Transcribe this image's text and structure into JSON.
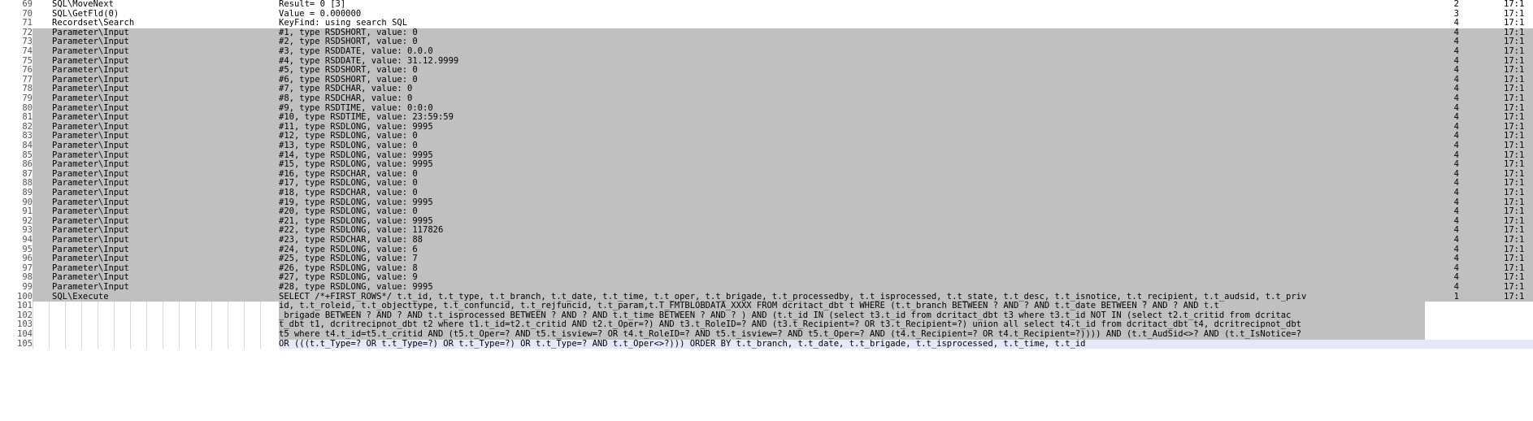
{
  "rows": [
    {
      "n": "69",
      "name": "SQL\\MoveNext",
      "msg": "Result= 0 [3]",
      "lvl": "2",
      "time": "17:1"
    },
    {
      "n": "70",
      "name": "SQL\\GetFld(0)",
      "msg": "Value = 0.000000",
      "lvl": "3",
      "time": "17:1"
    },
    {
      "n": "71",
      "name": "Recordset\\Search",
      "msg": "KeyFind: using search SQL",
      "lvl": "4",
      "time": "17:1"
    },
    {
      "n": "72",
      "name": "Parameter\\Input",
      "msg": "#1, type RSDSHORT, value: 0",
      "lvl": "4",
      "time": "17:1"
    },
    {
      "n": "73",
      "name": "Parameter\\Input",
      "msg": "#2, type RSDSHORT, value: 0",
      "lvl": "4",
      "time": "17:1"
    },
    {
      "n": "74",
      "name": "Parameter\\Input",
      "msg": "#3, type RSDDATE, value: 0.0.0",
      "lvl": "4",
      "time": "17:1"
    },
    {
      "n": "75",
      "name": "Parameter\\Input",
      "msg": "#4, type RSDDATE, value: 31.12.9999",
      "lvl": "4",
      "time": "17:1"
    },
    {
      "n": "76",
      "name": "Parameter\\Input",
      "msg": "#5, type RSDSHORT, value: 0",
      "lvl": "4",
      "time": "17:1"
    },
    {
      "n": "77",
      "name": "Parameter\\Input",
      "msg": "#6, type RSDSHORT, value: 0",
      "lvl": "4",
      "time": "17:1"
    },
    {
      "n": "78",
      "name": "Parameter\\Input",
      "msg": "#7, type RSDCHAR, value: 0",
      "lvl": "4",
      "time": "17:1"
    },
    {
      "n": "79",
      "name": "Parameter\\Input",
      "msg": "#8, type RSDCHAR, value: 0",
      "lvl": "4",
      "time": "17:1"
    },
    {
      "n": "80",
      "name": "Parameter\\Input",
      "msg": "#9, type RSDTIME, value: 0:0:0",
      "lvl": "4",
      "time": "17:1"
    },
    {
      "n": "81",
      "name": "Parameter\\Input",
      "msg": "#10, type RSDTIME, value: 23:59:59",
      "lvl": "4",
      "time": "17:1"
    },
    {
      "n": "82",
      "name": "Parameter\\Input",
      "msg": "#11, type RSDLONG, value: 9995",
      "lvl": "4",
      "time": "17:1"
    },
    {
      "n": "83",
      "name": "Parameter\\Input",
      "msg": "#12, type RSDLONG, value: 0",
      "lvl": "4",
      "time": "17:1"
    },
    {
      "n": "84",
      "name": "Parameter\\Input",
      "msg": "#13, type RSDLONG, value: 0",
      "lvl": "4",
      "time": "17:1"
    },
    {
      "n": "85",
      "name": "Parameter\\Input",
      "msg": "#14, type RSDLONG, value: 9995",
      "lvl": "4",
      "time": "17:1"
    },
    {
      "n": "86",
      "name": "Parameter\\Input",
      "msg": "#15, type RSDLONG, value: 9995",
      "lvl": "4",
      "time": "17:1"
    },
    {
      "n": "87",
      "name": "Parameter\\Input",
      "msg": "#16, type RSDCHAR, value: 0",
      "lvl": "4",
      "time": "17:1"
    },
    {
      "n": "88",
      "name": "Parameter\\Input",
      "msg": "#17, type RSDLONG, value: 0",
      "lvl": "4",
      "time": "17:1"
    },
    {
      "n": "89",
      "name": "Parameter\\Input",
      "msg": "#18, type RSDCHAR, value: 0",
      "lvl": "4",
      "time": "17:1"
    },
    {
      "n": "90",
      "name": "Parameter\\Input",
      "msg": "#19, type RSDLONG, value: 9995",
      "lvl": "4",
      "time": "17:1"
    },
    {
      "n": "91",
      "name": "Parameter\\Input",
      "msg": "#20, type RSDLONG, value: 0",
      "lvl": "4",
      "time": "17:1"
    },
    {
      "n": "92",
      "name": "Parameter\\Input",
      "msg": "#21, type RSDLONG, value: 9995",
      "lvl": "4",
      "time": "17:1"
    },
    {
      "n": "93",
      "name": "Parameter\\Input",
      "msg": "#22, type RSDLONG, value: 117826",
      "lvl": "4",
      "time": "17:1"
    },
    {
      "n": "94",
      "name": "Parameter\\Input",
      "msg": "#23, type RSDCHAR, value: 88",
      "lvl": "4",
      "time": "17:1"
    },
    {
      "n": "95",
      "name": "Parameter\\Input",
      "msg": "#24, type RSDLONG, value: 6",
      "lvl": "4",
      "time": "17:1"
    },
    {
      "n": "96",
      "name": "Parameter\\Input",
      "msg": "#25, type RSDLONG, value: 7",
      "lvl": "4",
      "time": "17:1"
    },
    {
      "n": "97",
      "name": "Parameter\\Input",
      "msg": "#26, type RSDLONG, value: 8",
      "lvl": "4",
      "time": "17:1"
    },
    {
      "n": "98",
      "name": "Parameter\\Input",
      "msg": "#27, type RSDLONG, value: 9",
      "lvl": "4",
      "time": "17:1"
    },
    {
      "n": "99",
      "name": "Parameter\\Input",
      "msg": "#28, type RSDLONG, value: 9995",
      "lvl": "4",
      "time": "17:1"
    },
    {
      "n": "100",
      "name": "SQL\\Execute",
      "msg": "SELECT /*+FIRST_ROWS*/ t.t_id, t.t_type, t.t_branch, t.t_date, t.t_time, t.t_oper, t.t_brigade, t.t_processedby, t.t_isprocessed, t.t_state, t.t_desc, t.t_isnotice, t.t_recipient, t.t_audsid, t.t_priv",
      "lvl": "1",
      "time": "17:1"
    }
  ],
  "continuation": [
    {
      "n": "101",
      "msg": "id, t.t_roleid, t.t_objecttype, t.t_confuncid, t.t_rejfuncid, t.t_param,t.T_FMTBLOBDATA_XXXX FROM dcritact_dbt t WHERE  (t.t_branch BETWEEN ? AND ?  AND t.t_date BETWEEN ? AND ?  AND t.t"
    },
    {
      "n": "102",
      "msg": "_brigade BETWEEN ? AND ?  AND t.t_isprocessed BETWEEN ? AND ?  AND t.t_time BETWEEN ? AND ? ) AND  (t.t_id IN (select t3.t_id from dcritact_dbt t3 where t3.t_id NOT IN (select t2.t_critid from dcritac"
    },
    {
      "n": "103",
      "msg": "t_dbt t1, dcritrecipnot_dbt t2 where t1.t_id=t2.t_critid AND t2.t_Oper=?) AND t3.t_RoleID=? AND (t3.t_Recipient=? OR t3.t_Recipient=?) union all select t4.t_id from dcritact_dbt t4, dcritrecipnot_dbt"
    },
    {
      "n": "104",
      "msg": "t5 where t4.t_id=t5.t_critid AND (t5.t_Oper=? AND t5.t_isview=? OR t4.t_RoleID=? AND t5.t_isview=? AND t5.t_Oper=? AND (t4.t_Recipient=? OR t4.t_Recipient=?)))) AND  (t.t_AudSid<>? AND (t.t_IsNotice=?"
    },
    {
      "n": "105",
      "msg": " OR (((t.t_Type=? OR t.t_Type=?) OR t.t_Type=?) OR t.t_Type=? AND t.t_Oper<>?))) ORDER BY t.t_branch, t.t_date, t.t_brigade, t.t_isprocessed, t.t_time, t.t_id"
    }
  ]
}
